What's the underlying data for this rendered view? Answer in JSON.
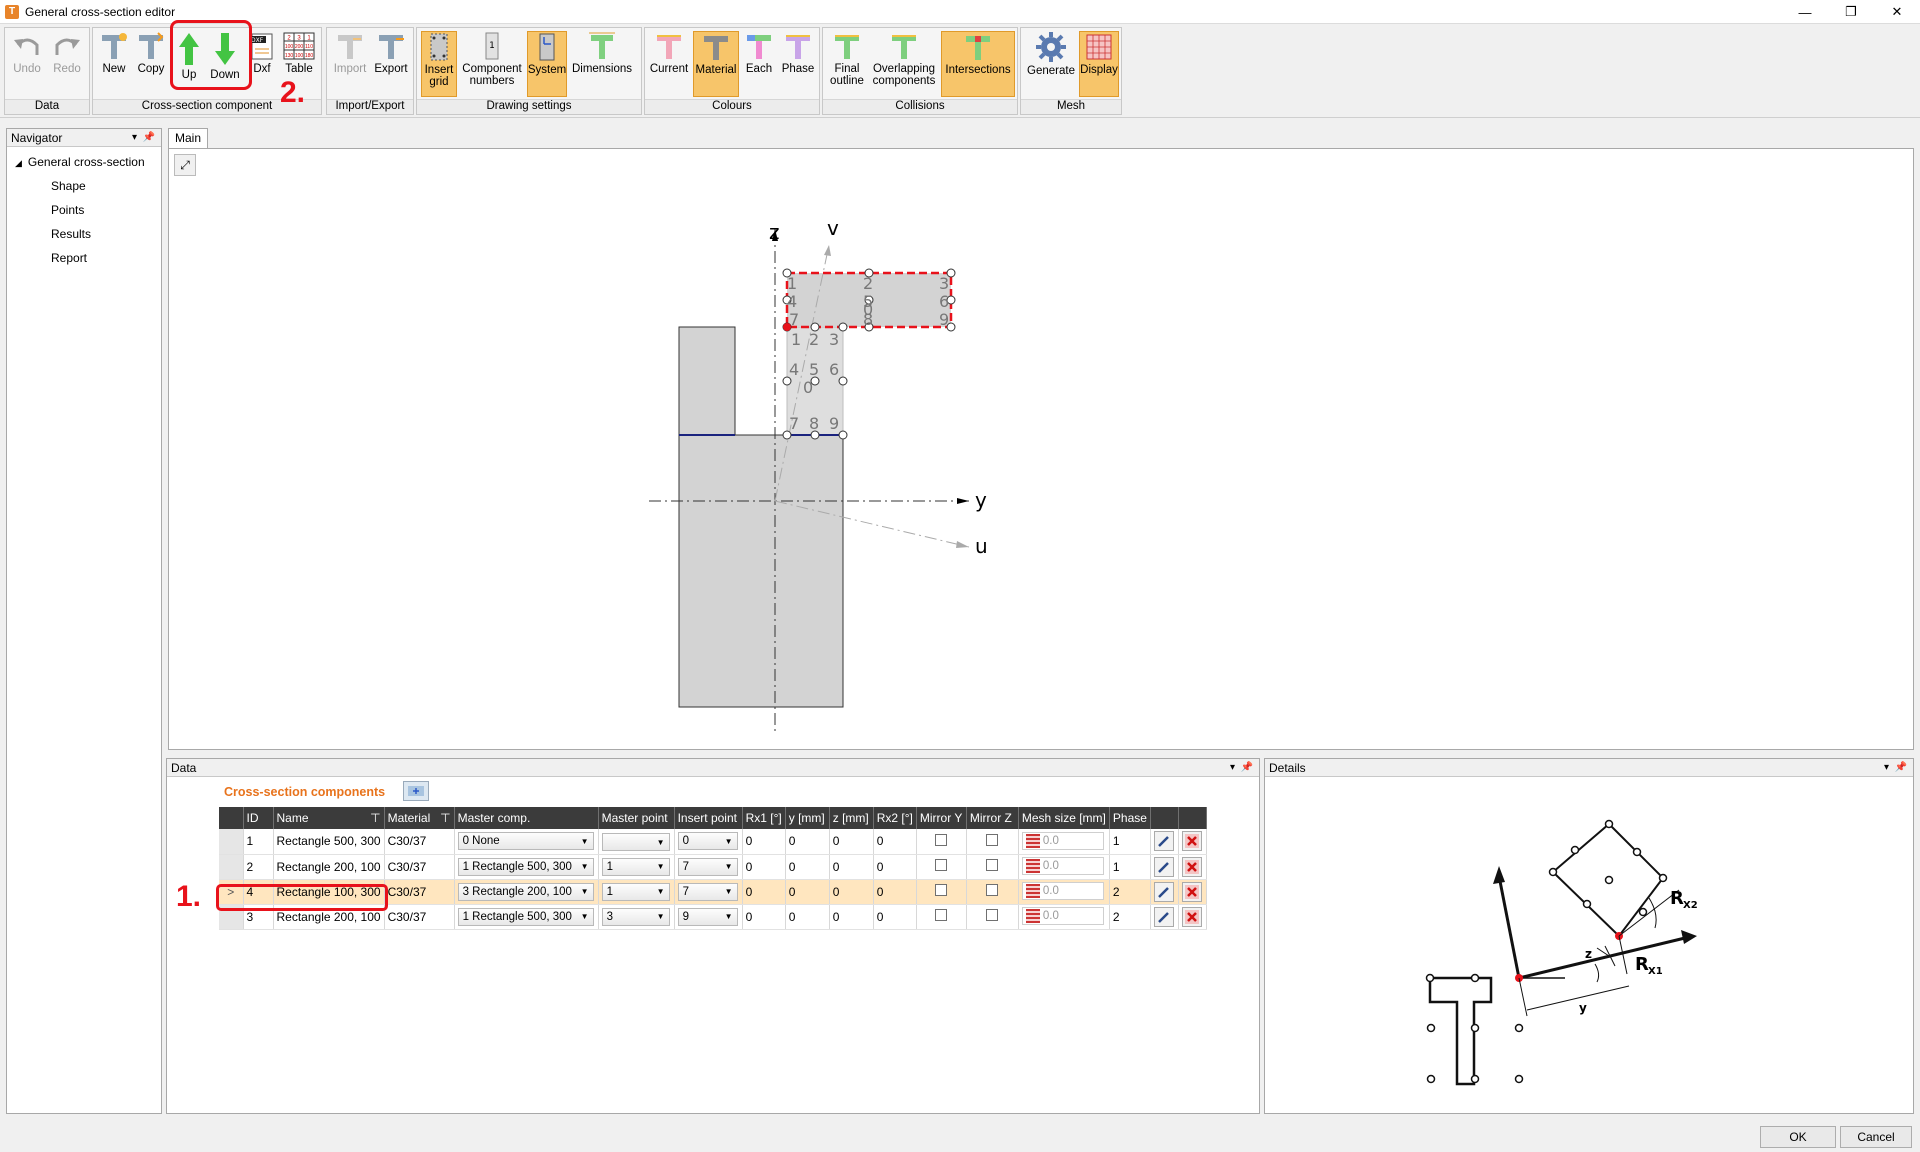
{
  "window": {
    "title": "General cross-section editor",
    "app_icon": "T",
    "minimize": "—",
    "maximize": "❐",
    "close": "✕"
  },
  "ribbon": {
    "groups": {
      "data": "Data",
      "component": "Cross-section component",
      "import_export": "Import/Export",
      "drawing": "Drawing settings",
      "colours": "Colours",
      "collisions": "Collisions",
      "mesh": "Mesh"
    },
    "buttons": {
      "undo": "Undo",
      "redo": "Redo",
      "new": "New",
      "copy": "Copy",
      "up": "Up",
      "down": "Down",
      "dxf": "Dxf",
      "table": "Table",
      "import": "Import",
      "export": "Export",
      "insert_grid_1": "Insert",
      "insert_grid_2": "grid",
      "component_numbers_1": "Component",
      "component_numbers_2": "numbers",
      "system": "System",
      "dimensions": "Dimensions",
      "current": "Current",
      "material": "Material",
      "each": "Each",
      "phase": "Phase",
      "final_outline_1": "Final",
      "final_outline_2": "outline",
      "overlapping_1": "Overlapping",
      "overlapping_2": "components",
      "intersections": "Intersections",
      "generate": "Generate",
      "display": "Display"
    },
    "table_icon_values": [
      "2",
      "3",
      "1",
      "100",
      "200",
      "110",
      "130",
      "100",
      "180"
    ]
  },
  "annotations": {
    "step1": "1.",
    "step2": "2."
  },
  "navigator": {
    "title": "Navigator",
    "root": "General cross-section",
    "items": [
      "Shape",
      "Points",
      "Results",
      "Report"
    ]
  },
  "main": {
    "tab": "Main",
    "axes": {
      "z": "z",
      "v": "v",
      "y": "y",
      "u": "u"
    },
    "comp1_points": [
      "1",
      "2",
      "3",
      "4",
      "5",
      "6",
      "7",
      "8",
      "9",
      "0"
    ],
    "comp4_points": [
      "4",
      "5",
      "6",
      "7",
      "8",
      "9",
      "0"
    ]
  },
  "data_panel": {
    "title": "Data",
    "section_title": "Cross-section components",
    "columns": [
      "ID",
      "Name",
      "Material",
      "Master comp.",
      "Master point",
      "Insert point",
      "Rx1 [°]",
      "y [mm]",
      "z [mm]",
      "Rx2 [°]",
      "Mirror Y",
      "Mirror Z",
      "Mesh size [mm]",
      "Phase"
    ],
    "rows": [
      {
        "id": "1",
        "name": "Rectangle 500, 300",
        "material": "C30/37",
        "master_comp": "0 None",
        "master_point": "",
        "insert_point": "0",
        "rx1": "0",
        "y": "0",
        "z": "0",
        "rx2": "0",
        "mesh": "0.0",
        "phase": "1",
        "selected": false
      },
      {
        "id": "2",
        "name": "Rectangle 200, 100",
        "material": "C30/37",
        "master_comp": "1 Rectangle 500, 300",
        "master_point": "1",
        "insert_point": "7",
        "rx1": "0",
        "y": "0",
        "z": "0",
        "rx2": "0",
        "mesh": "0.0",
        "phase": "1",
        "selected": false
      },
      {
        "id": "4",
        "name": "Rectangle 100, 300",
        "material": "C30/37",
        "master_comp": "3 Rectangle 200, 100",
        "master_point": "1",
        "insert_point": "7",
        "rx1": "0",
        "y": "0",
        "z": "0",
        "rx2": "0",
        "mesh": "0.0",
        "phase": "2",
        "selected": true,
        "row_marker": ">"
      },
      {
        "id": "3",
        "name": "Rectangle 200, 100",
        "material": "C30/37",
        "master_comp": "1 Rectangle 500, 300",
        "master_point": "3",
        "insert_point": "9",
        "rx1": "0",
        "y": "0",
        "z": "0",
        "rx2": "0",
        "mesh": "0.0",
        "phase": "2",
        "selected": false
      }
    ]
  },
  "details": {
    "title": "Details",
    "labels": {
      "rx2": "R",
      "rx2_sub": "X2",
      "rx1": "R",
      "rx1_sub": "X1",
      "z": "z",
      "y": "y"
    }
  },
  "footer": {
    "ok": "OK",
    "cancel": "Cancel"
  },
  "colors": {
    "accent_orange": "#f7c56a",
    "annotation_red": "#e8121b",
    "selection_row": "#ffe6bf",
    "grid_header": "#3b3b3b"
  }
}
